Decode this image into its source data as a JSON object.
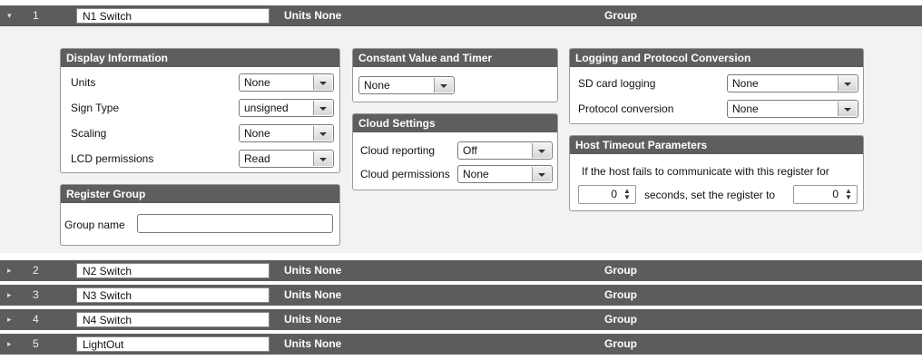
{
  "registers": [
    {
      "num": "1",
      "name": "N1 Switch",
      "units": "Units None",
      "group": "Group",
      "expanded": true
    },
    {
      "num": "2",
      "name": "N2 Switch",
      "units": "Units None",
      "group": "Group",
      "expanded": false
    },
    {
      "num": "3",
      "name": "N3 Switch",
      "units": "Units None",
      "group": "Group",
      "expanded": false
    },
    {
      "num": "4",
      "name": "N4 Switch",
      "units": "Units None",
      "group": "Group",
      "expanded": false
    },
    {
      "num": "5",
      "name": "LightOut",
      "units": "Units None",
      "group": "Group",
      "expanded": false
    }
  ],
  "toggle_icons": {
    "expanded": "▾",
    "collapsed": "▸"
  },
  "display_information": {
    "title": "Display Information",
    "units_label": "Units",
    "units_value": "None",
    "sign_type_label": "Sign Type",
    "sign_type_value": "unsigned",
    "scaling_label": "Scaling",
    "scaling_value": "None",
    "lcd_label": "LCD permissions",
    "lcd_value": "Read"
  },
  "register_group": {
    "title": "Register Group",
    "group_name_label": "Group name",
    "group_name_value": ""
  },
  "constant_value": {
    "title": "Constant Value and Timer",
    "value": "None"
  },
  "cloud_settings": {
    "title": "Cloud Settings",
    "reporting_label": "Cloud reporting",
    "reporting_value": "Off",
    "permissions_label": "Cloud permissions",
    "permissions_value": "None"
  },
  "logging": {
    "title": "Logging and Protocol Conversion",
    "sd_label": "SD card logging",
    "sd_value": "None",
    "protocol_label": "Protocol conversion",
    "protocol_value": "None"
  },
  "host_timeout": {
    "title": "Host Timeout Parameters",
    "description": "If the host fails to communicate with this register for",
    "seconds_value": "0",
    "mid_text": "seconds, set the register to",
    "register_value": "0"
  },
  "colors": {
    "header_bar": "#5c5c5c",
    "panel_header": "#5e5e5e",
    "expanded_bg": "#f2f2f2"
  }
}
